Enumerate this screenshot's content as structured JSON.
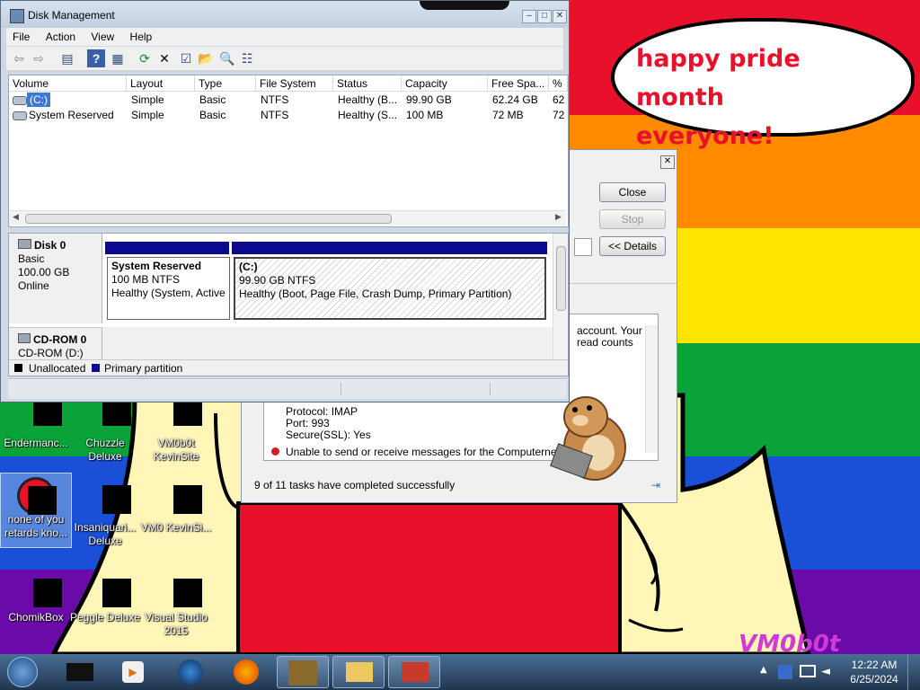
{
  "bubble": {
    "line1": "happy pride month",
    "line2": "everyone!"
  },
  "watermark": "VM0b0t",
  "desktop_icons": [
    {
      "label": "Endermanc...",
      "icon": "ender-icon"
    },
    {
      "label": "Chuzzle Deluxe",
      "icon": "chuzzle-icon"
    },
    {
      "label": "VM0b0t KevinSite",
      "icon": "vm0b0t-icon"
    },
    {
      "label": "none of you retards kno...",
      "icon": "shortcut-icon"
    },
    {
      "label": "Insaniquari... Deluxe",
      "icon": "insaniquarium-icon"
    },
    {
      "label": "VM0 KevinSi...",
      "icon": "vm0-icon"
    },
    {
      "label": "ChomikBox",
      "icon": "chomikbox-icon"
    },
    {
      "label": "Peggle Deluxe",
      "icon": "peggle-icon"
    },
    {
      "label": "Visual Studio 2015",
      "icon": "visual-studio-icon"
    }
  ],
  "disk_mgmt": {
    "title": "Disk Management",
    "menu": [
      "File",
      "Action",
      "View",
      "Help"
    ],
    "columns": [
      "Volume",
      "Layout",
      "Type",
      "File System",
      "Status",
      "Capacity",
      "Free Spa...",
      "%"
    ],
    "rows": [
      [
        "(C:)",
        "Simple",
        "Basic",
        "NTFS",
        "Healthy (B...",
        "99.90 GB",
        "62.24 GB",
        "62"
      ],
      [
        "System Reserved",
        "Simple",
        "Basic",
        "NTFS",
        "Healthy (S...",
        "100 MB",
        "72 MB",
        "72"
      ]
    ],
    "disk0": {
      "name": "Disk 0",
      "type": "Basic",
      "size": "100.00 GB",
      "state": "Online",
      "partitions": [
        {
          "name": "System Reserved",
          "size": "100 MB NTFS",
          "status": "Healthy (System, Active"
        },
        {
          "name": "(C:)",
          "size": "99.90 GB NTFS",
          "status": "Healthy (Boot, Page File, Crash Dump, Primary Partition)"
        }
      ]
    },
    "cdrom": {
      "name": "CD-ROM 0",
      "drive": "CD-ROM (D:)"
    },
    "legend": [
      {
        "label": "Unallocated",
        "color": "#000000"
      },
      {
        "label": "Primary partition",
        "color": "#0a0a90"
      }
    ]
  },
  "send_receive": {
    "close": "Close",
    "stop": "Stop",
    "details": "<< Details",
    "detail_lines": [
      "account. Your",
      "read counts"
    ],
    "protocol": "Protocol: IMAP",
    "port": "Port: 993",
    "secure": "Secure(SSL): Yes",
    "error": "Unable to send or receive messages for the Computernewb (vm0",
    "summary": "9 of 11 tasks have completed successfully"
  },
  "taskbar": {
    "time": "12:22 AM",
    "date": "6/25/2024"
  },
  "colors": {
    "red": "#e8102a",
    "orange": "#ff8a00",
    "yellow": "#ffe600",
    "green": "#0aa33a",
    "blue": "#1a4fd8",
    "purple": "#6a0aa8"
  }
}
